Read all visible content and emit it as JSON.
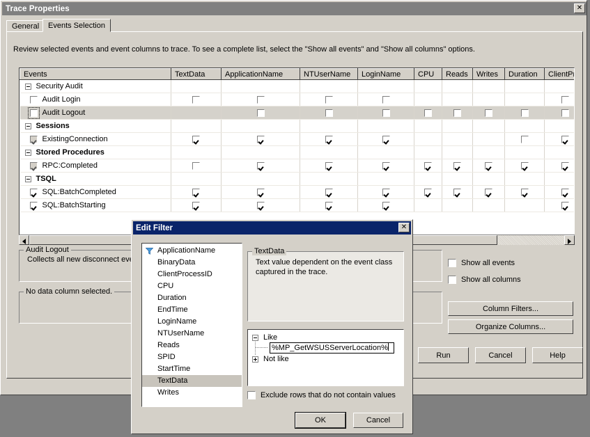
{
  "window": {
    "title": "Trace Properties",
    "close_label": "✕"
  },
  "tabs": [
    {
      "label": "General",
      "selected": false
    },
    {
      "label": "Events Selection",
      "selected": true
    }
  ],
  "instructions": "Review selected events and event columns to trace. To see a complete list, select the \"Show all events\" and \"Show all columns\" options.",
  "grid": {
    "columns": [
      "Events",
      "TextData",
      "ApplicationName",
      "NTUserName",
      "LoginName",
      "CPU",
      "Reads",
      "Writes",
      "Duration",
      "ClientProcess"
    ],
    "rows": [
      {
        "type": "category",
        "label": "Security Audit",
        "bold": false,
        "cells": [
          "",
          "",
          "",
          "",
          "",
          "",
          "",
          "",
          ""
        ]
      },
      {
        "type": "event",
        "label": "Audit Login",
        "checked": false,
        "disabled": false,
        "selected": false,
        "cells": [
          "off",
          "off",
          "off",
          "off",
          "",
          "",
          "",
          "",
          "off"
        ]
      },
      {
        "type": "event",
        "label": "Audit Logout",
        "checked": false,
        "disabled": false,
        "selected": true,
        "focused": true,
        "cells": [
          "",
          "off",
          "off",
          "off",
          "off",
          "off",
          "off",
          "off",
          "off"
        ]
      },
      {
        "type": "category",
        "label": "Sessions",
        "bold": true,
        "cells": [
          "",
          "",
          "",
          "",
          "",
          "",
          "",
          "",
          ""
        ]
      },
      {
        "type": "event",
        "label": "ExistingConnection",
        "checked": true,
        "disabled": true,
        "selected": false,
        "cells": [
          "on",
          "on",
          "on",
          "on",
          "",
          "",
          "",
          "off",
          "on"
        ]
      },
      {
        "type": "category",
        "label": "Stored Procedures",
        "bold": true,
        "cells": [
          "",
          "",
          "",
          "",
          "",
          "",
          "",
          "",
          ""
        ]
      },
      {
        "type": "event",
        "label": "RPC:Completed",
        "checked": true,
        "disabled": true,
        "selected": false,
        "cells": [
          "off",
          "on",
          "on",
          "on",
          "on",
          "on",
          "on",
          "on",
          "on"
        ]
      },
      {
        "type": "category",
        "label": "TSQL",
        "bold": true,
        "cells": [
          "",
          "",
          "",
          "",
          "",
          "",
          "",
          "",
          ""
        ]
      },
      {
        "type": "event",
        "label": "SQL:BatchCompleted",
        "checked": true,
        "disabled": false,
        "selected": false,
        "cells": [
          "on",
          "on",
          "on",
          "on",
          "on",
          "on",
          "on",
          "on",
          "on"
        ]
      },
      {
        "type": "event",
        "label": "SQL:BatchStarting",
        "checked": true,
        "disabled": false,
        "selected": false,
        "cells": [
          "on",
          "on",
          "on",
          "on",
          "",
          "",
          "",
          "",
          "on"
        ]
      }
    ]
  },
  "event_description": {
    "title": "Audit Logout",
    "text": "Collects all new disconnect eve"
  },
  "column_description": {
    "title": "No data column selected.",
    "text": ""
  },
  "options": {
    "show_all_events": "Show all events",
    "show_all_columns": "Show all columns"
  },
  "buttons": {
    "column_filters": "Column Filters...",
    "organize_columns": "Organize Columns...",
    "run": "Run",
    "cancel": "Cancel",
    "help": "Help"
  },
  "edit_filter": {
    "title": "Edit Filter",
    "close_label": "✕",
    "columns": [
      {
        "label": "ApplicationName",
        "has_filter": true,
        "selected": false
      },
      {
        "label": "BinaryData",
        "has_filter": false,
        "selected": false
      },
      {
        "label": "ClientProcessID",
        "has_filter": false,
        "selected": false
      },
      {
        "label": "CPU",
        "has_filter": false,
        "selected": false
      },
      {
        "label": "Duration",
        "has_filter": false,
        "selected": false
      },
      {
        "label": "EndTime",
        "has_filter": false,
        "selected": false
      },
      {
        "label": "LoginName",
        "has_filter": false,
        "selected": false
      },
      {
        "label": "NTUserName",
        "has_filter": false,
        "selected": false
      },
      {
        "label": "Reads",
        "has_filter": false,
        "selected": false
      },
      {
        "label": "SPID",
        "has_filter": false,
        "selected": false
      },
      {
        "label": "StartTime",
        "has_filter": false,
        "selected": false
      },
      {
        "label": "TextData",
        "has_filter": false,
        "selected": true
      },
      {
        "label": "Writes",
        "has_filter": false,
        "selected": false
      }
    ],
    "description": {
      "title": "TextData",
      "text": "Text value dependent on the event class captured in the trace."
    },
    "tree": {
      "like_label": "Like",
      "like_value": "%MP_GetWSUSServerLocation%",
      "not_like_label": "Not like"
    },
    "exclude_label": "Exclude rows that do not contain values",
    "ok_label": "OK",
    "cancel_label": "Cancel"
  },
  "colors": {
    "face": "#d4d0c8",
    "desktop": "#808080",
    "inactive_title": "#808080",
    "active_title": "#0a246a",
    "selection": "#c8c4bc"
  }
}
